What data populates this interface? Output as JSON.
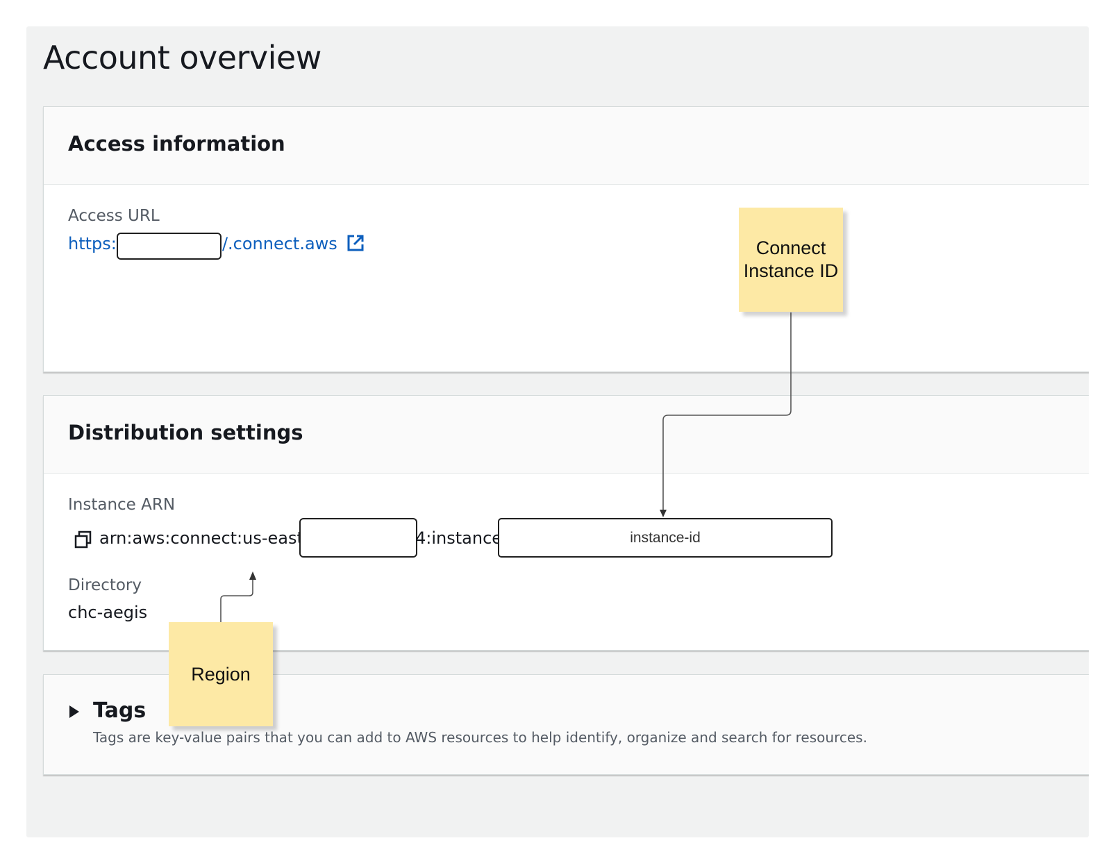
{
  "page": {
    "title": "Account overview"
  },
  "access_information": {
    "heading": "Access information",
    "url_label": "Access URL",
    "url_prefix": "https:/",
    "url_suffix": "/.connect.aws",
    "external_icon": "external-link-icon"
  },
  "distribution_settings": {
    "heading": "Distribution settings",
    "arn_label": "Instance ARN",
    "copy_icon": "copy-icon",
    "arn_prefix": "arn:aws:connect:us-east-1",
    "arn_middle": "4:instance/",
    "instance_id_placeholder": "instance-id",
    "directory_label": "Directory",
    "directory_value": "chc-aegis"
  },
  "tags": {
    "heading": "Tags",
    "expand_icon": "caret-right-icon",
    "description": "Tags are key-value pairs that you can add to AWS resources to help identify, organize and search for resources."
  },
  "annotations": {
    "connect_instance_id": "Connect Instance ID",
    "region": "Region"
  }
}
